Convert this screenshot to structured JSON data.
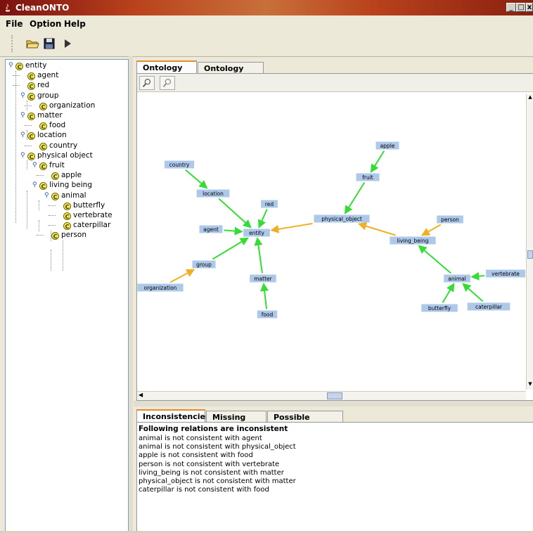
{
  "window": {
    "title": "CleanONTO",
    "controls": [
      "_",
      "□",
      "x"
    ]
  },
  "menu": {
    "items": [
      "File",
      "Option",
      "Help"
    ]
  },
  "toolbar": {
    "buttons": [
      "open-folder-icon",
      "save-icon",
      "run-icon"
    ]
  },
  "tree": {
    "nodes": [
      {
        "label": "entity",
        "depth": 0,
        "expandable": true
      },
      {
        "label": "agent",
        "depth": 1
      },
      {
        "label": "red",
        "depth": 1
      },
      {
        "label": "group",
        "depth": 1,
        "expandable": true
      },
      {
        "label": "organization",
        "depth": 2
      },
      {
        "label": "matter",
        "depth": 1,
        "expandable": true
      },
      {
        "label": "food",
        "depth": 2
      },
      {
        "label": "location",
        "depth": 1,
        "expandable": true
      },
      {
        "label": "country",
        "depth": 2
      },
      {
        "label": "physical object",
        "depth": 1,
        "expandable": true
      },
      {
        "label": "fruit",
        "depth": 2,
        "expandable": true
      },
      {
        "label": "apple",
        "depth": 3
      },
      {
        "label": "living being",
        "depth": 2,
        "expandable": true
      },
      {
        "label": "animal",
        "depth": 3,
        "expandable": true
      },
      {
        "label": "butterfly",
        "depth": 4
      },
      {
        "label": "vertebrate",
        "depth": 4
      },
      {
        "label": "caterpillar",
        "depth": 4
      },
      {
        "label": "person",
        "depth": 3
      }
    ]
  },
  "top_tabs": [
    "Ontology Tree",
    "Ontology Editor"
  ],
  "zoom_buttons": [
    "zoom-in-icon",
    "zoom-out-icon"
  ],
  "graph": {
    "nodes": [
      {
        "id": "country",
        "label": "country"
      },
      {
        "id": "location",
        "label": "location"
      },
      {
        "id": "red",
        "label": "red"
      },
      {
        "id": "agent",
        "label": "agent"
      },
      {
        "id": "entity",
        "label": "entity"
      },
      {
        "id": "group",
        "label": "group"
      },
      {
        "id": "organization",
        "label": "organization"
      },
      {
        "id": "matter",
        "label": "matter"
      },
      {
        "id": "food",
        "label": "food"
      },
      {
        "id": "apple",
        "label": "apple"
      },
      {
        "id": "fruit",
        "label": "fruit"
      },
      {
        "id": "physical_object",
        "label": "physical_object"
      },
      {
        "id": "person",
        "label": "person"
      },
      {
        "id": "living_being",
        "label": "living_being"
      },
      {
        "id": "animal",
        "label": "animal"
      },
      {
        "id": "vertebrate",
        "label": "vertebrate"
      },
      {
        "id": "butterfly",
        "label": "butterfly"
      },
      {
        "id": "caterpillar",
        "label": "caterpillar"
      }
    ],
    "edges": [
      {
        "from": "country",
        "to": "location",
        "color": "#33dd33"
      },
      {
        "from": "location",
        "to": "entity",
        "color": "#33dd33"
      },
      {
        "from": "red",
        "to": "entity",
        "color": "#33dd33"
      },
      {
        "from": "agent",
        "to": "entity",
        "color": "#33dd33"
      },
      {
        "from": "group",
        "to": "entity",
        "color": "#33dd33"
      },
      {
        "from": "organization",
        "to": "group",
        "color": "#f0b020"
      },
      {
        "from": "matter",
        "to": "entity",
        "color": "#33dd33"
      },
      {
        "from": "food",
        "to": "matter",
        "color": "#33dd33"
      },
      {
        "from": "physical_object",
        "to": "entity",
        "color": "#f0b020"
      },
      {
        "from": "apple",
        "to": "fruit",
        "color": "#33dd33"
      },
      {
        "from": "fruit",
        "to": "physical_object",
        "color": "#33dd33"
      },
      {
        "from": "living_being",
        "to": "physical_object",
        "color": "#f0b020"
      },
      {
        "from": "person",
        "to": "living_being",
        "color": "#f0b020"
      },
      {
        "from": "animal",
        "to": "living_being",
        "color": "#33dd33"
      },
      {
        "from": "vertebrate",
        "to": "animal",
        "color": "#33dd33"
      },
      {
        "from": "butterfly",
        "to": "animal",
        "color": "#33dd33"
      },
      {
        "from": "caterpillar",
        "to": "animal",
        "color": "#33dd33"
      }
    ]
  },
  "bottom_tabs": [
    "Inconsistencies",
    "Missing words",
    "Possible relations"
  ],
  "inconsistencies": {
    "header": "Following relations are inconsistent",
    "lines": [
      "animal is not consistent with agent",
      "animal is not consistent with physical_object",
      "apple is not consistent with food",
      "person is not consistent with vertebrate",
      "living_being is not consistent with matter",
      "physical_object is not consistent with matter",
      "caterpillar is not consistent with food"
    ]
  }
}
